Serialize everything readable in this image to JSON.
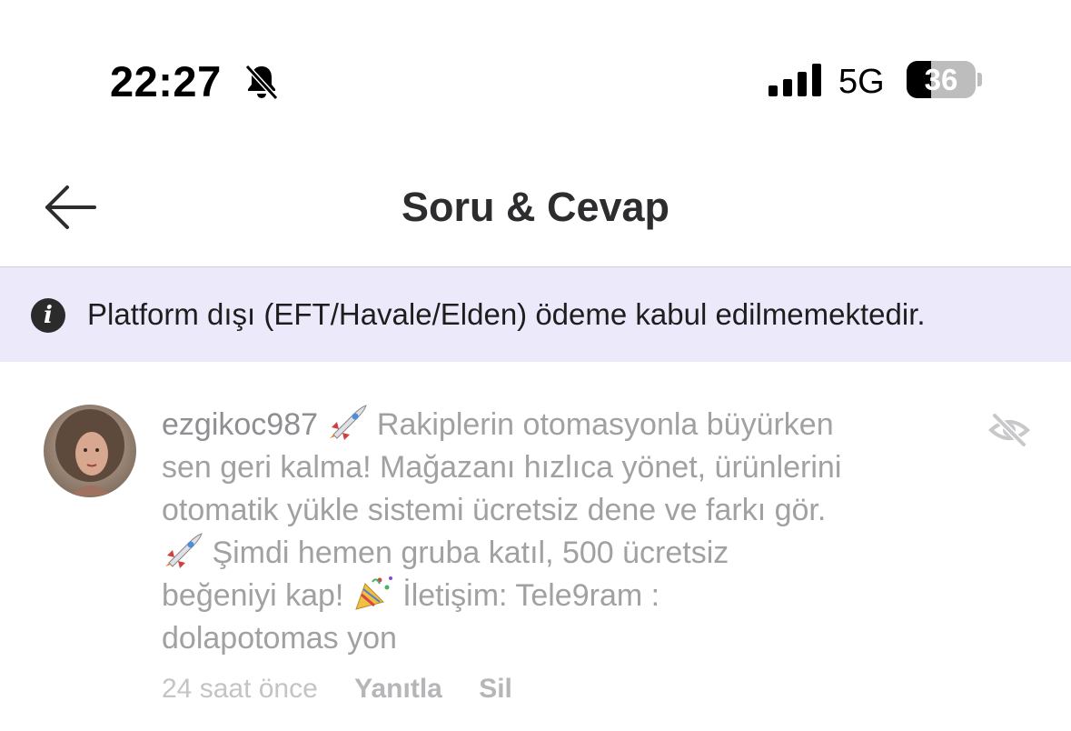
{
  "status_bar": {
    "time": "22:27",
    "network": "5G",
    "battery": "36",
    "battery_level": 0.36,
    "icons": [
      "bell-slash-icon",
      "signal-icon",
      "battery-icon"
    ]
  },
  "header": {
    "title": "Soru & Cevap",
    "back_icon": "arrow-left-icon"
  },
  "banner": {
    "icon": "info-icon",
    "icon_glyph": "i",
    "text": "Platform dışı (EFT/Havale/Elden) ödeme kabul edilmemektedir."
  },
  "comment": {
    "username": "ezgikoc987",
    "lines": [
      " Rakiplerin otomasyonla büyürken",
      "sen geri kalma! Mağazanı hızlıca yönet, ürünlerini",
      "otomatik yükle sistemi ücretsiz dene ve farkı gör.",
      " Şimdi hemen gruba katıl, 500 ücretsiz",
      "beğeniyi kap!",
      " İletişim: Tele9ram :",
      "dolapotomas yon"
    ],
    "emoji_icons": [
      "rocket-emoji-icon",
      "rocket-emoji-icon",
      "party-popper-emoji-icon"
    ],
    "hide_icon": "eye-slash-icon",
    "time_ago": "24 saat önce",
    "reply_label": "Yanıtla",
    "delete_label": "Sil"
  }
}
